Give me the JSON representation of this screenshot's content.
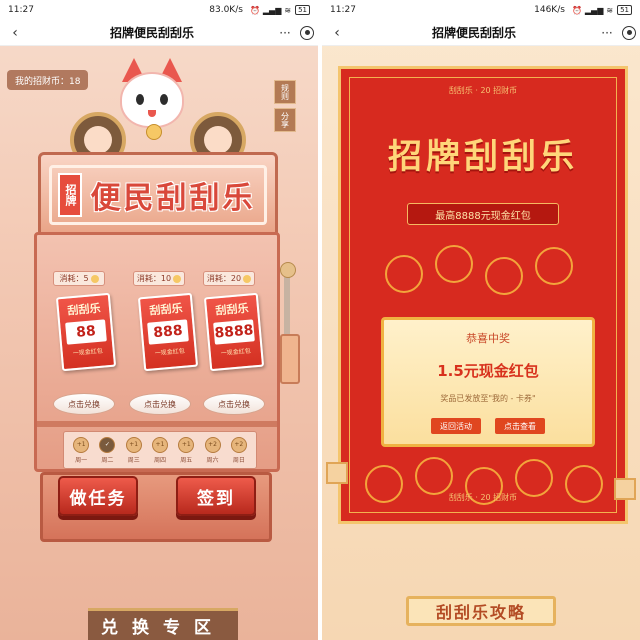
{
  "left": {
    "status": {
      "time": "11:27",
      "speed": "83.0K/s",
      "battery": "51"
    },
    "nav": {
      "back": "‹",
      "title": "招牌便民刮刮乐",
      "more": "···"
    },
    "coins": "我的招财币：18",
    "side_buttons": [
      "规则",
      "分享"
    ],
    "sign": {
      "tag": "招牌",
      "title": "便民刮刮乐"
    },
    "costs": [
      "消耗：5",
      "消耗：10",
      "消耗：20"
    ],
    "cards": [
      {
        "title": "刮刮乐",
        "amount": "88",
        "sub": "一现金红包"
      },
      {
        "title": "刮刮乐",
        "amount": "888",
        "sub": "一现金红包"
      },
      {
        "title": "刮刮乐",
        "amount": "8888",
        "sub": "一现金红包"
      }
    ],
    "redeem_label": "点击兑换",
    "days": [
      {
        "badge": "+1",
        "label": "周一",
        "done": false
      },
      {
        "badge": "✓",
        "label": "周二",
        "done": true
      },
      {
        "badge": "+1",
        "label": "周三",
        "done": false
      },
      {
        "badge": "+1",
        "label": "周四",
        "done": false
      },
      {
        "badge": "+1",
        "label": "周五",
        "done": false
      },
      {
        "badge": "+2",
        "label": "周六",
        "done": false
      },
      {
        "badge": "+2",
        "label": "周日",
        "done": false
      }
    ],
    "task_button": "做任务",
    "signin_button": "签到",
    "zone_title": "兑换专区"
  },
  "right": {
    "status": {
      "time": "11:27",
      "speed": "146K/s",
      "battery": "51"
    },
    "nav": {
      "back": "‹",
      "title": "招牌便民刮刮乐",
      "more": "···"
    },
    "strip_text": "刮刮乐 · 20 招财币",
    "title": "招牌刮刮乐",
    "subtitle": "最高8888元现金红包",
    "prize": {
      "heading": "恭喜中奖",
      "value": "1.5元现金红包",
      "note": "奖品已发放至\"我的 - 卡券\"",
      "back_button": "返回活动",
      "view_button": "点击查看"
    },
    "guide_title": "刮刮乐攻略"
  },
  "colors": {
    "brand_red": "#d72a1f",
    "gold": "#f4c56d",
    "peach": "#f3c9b4"
  }
}
